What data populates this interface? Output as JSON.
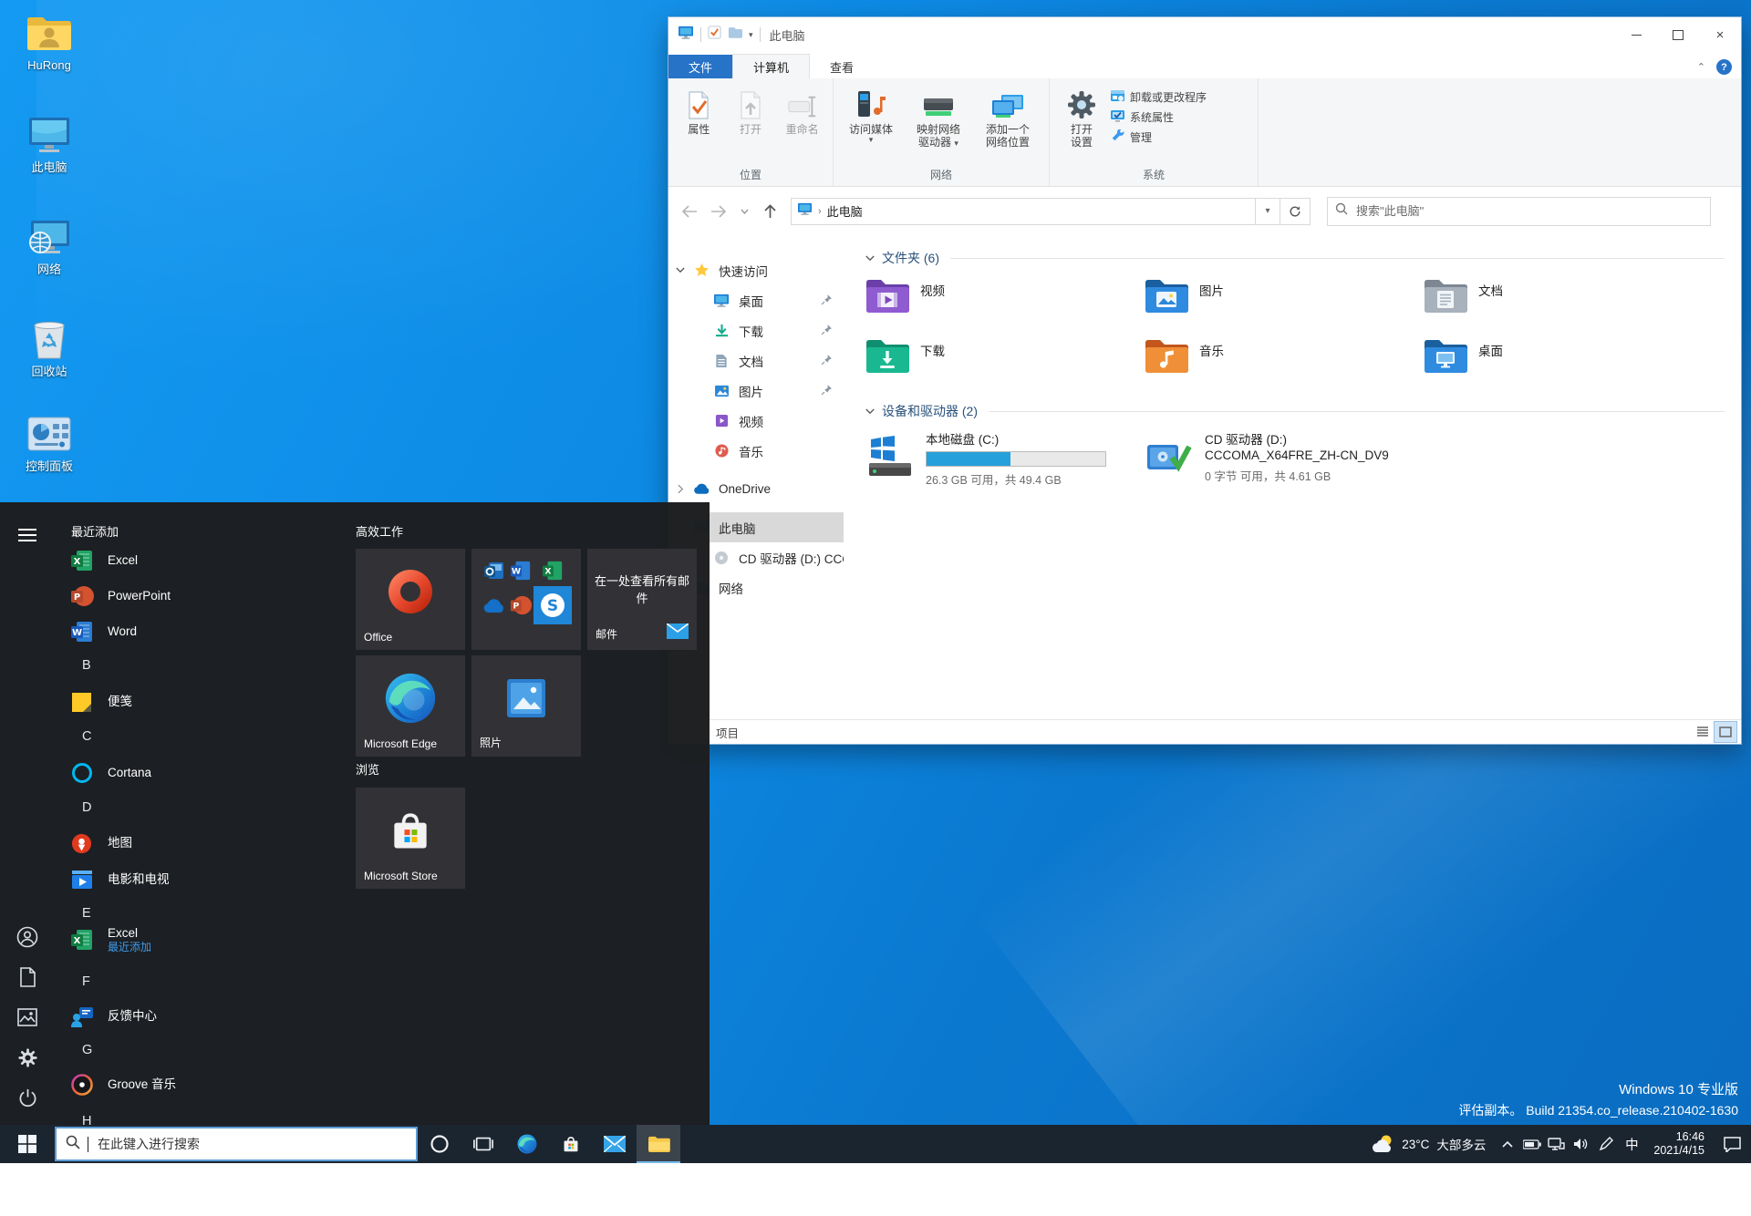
{
  "desktop": {
    "icons": [
      {
        "key": "hurong",
        "label": "HuRong"
      },
      {
        "key": "thispc",
        "label": "此电脑"
      },
      {
        "key": "network",
        "label": "网络"
      },
      {
        "key": "recycle",
        "label": "回收站"
      },
      {
        "key": "controlpanel",
        "label": "控制面板"
      }
    ],
    "watermark1": "Windows 10 专业版",
    "watermark2": "评估副本。 Build 21354.co_release.210402-1630"
  },
  "explorer": {
    "title": "此电脑",
    "tabs": {
      "file": "文件",
      "computer": "计算机",
      "view": "查看"
    },
    "ribbon": {
      "loc_group": {
        "label": "位置",
        "properties": "属性",
        "open": "打开",
        "rename": "重命名"
      },
      "net_group": {
        "label": "网络",
        "media": "访问媒体",
        "map1": "映射网络",
        "map2": "驱动器",
        "add1": "添加一个",
        "add2": "网络位置"
      },
      "sys_group": {
        "label": "系统",
        "settings1": "打开",
        "settings2": "设置",
        "uninstall": "卸载或更改程序",
        "sysprops": "系统属性",
        "manage": "管理"
      }
    },
    "address": "此电脑",
    "search_placeholder": "搜索\"此电脑\"",
    "sidebar": {
      "quick_access": "快速访问",
      "quick_items": [
        {
          "key": "desktop",
          "label": "桌面",
          "pinned": true
        },
        {
          "key": "downloads",
          "label": "下载",
          "pinned": true
        },
        {
          "key": "documents",
          "label": "文档",
          "pinned": true
        },
        {
          "key": "pictures",
          "label": "图片",
          "pinned": true
        },
        {
          "key": "videos",
          "label": "视频",
          "pinned": false
        },
        {
          "key": "music",
          "label": "音乐",
          "pinned": false
        }
      ],
      "onedrive": "OneDrive",
      "this_pc": "此电脑",
      "cd_drive": "CD 驱动器 (D:) CCC",
      "network": "网络"
    },
    "content": {
      "folders_header": "文件夹 (6)",
      "folders": [
        {
          "key": "videos",
          "name": "视频"
        },
        {
          "key": "pictures",
          "name": "图片"
        },
        {
          "key": "documents",
          "name": "文档"
        },
        {
          "key": "downloads",
          "name": "下载"
        },
        {
          "key": "music",
          "name": "音乐"
        },
        {
          "key": "desktop",
          "name": "桌面"
        }
      ],
      "drives_header": "设备和驱动器 (2)",
      "local_disk": {
        "name": "本地磁盘 (C:)",
        "info": "26.3 GB 可用，共 49.4 GB",
        "used_percent": 47
      },
      "cd_drive": {
        "name": "CD 驱动器 (D:)",
        "volume": "CCCOMA_X64FRE_ZH-CN_DV9",
        "info": "0 字节 可用，共 4.61 GB"
      }
    },
    "status_items": "项目"
  },
  "start_menu": {
    "recent_header": "最近添加",
    "app_list": [
      {
        "type": "app",
        "key": "excel",
        "label": "Excel"
      },
      {
        "type": "app",
        "key": "powerpoint",
        "label": "PowerPoint"
      },
      {
        "type": "app",
        "key": "word",
        "label": "Word"
      },
      {
        "type": "letter",
        "label": "B"
      },
      {
        "type": "app",
        "key": "stickynotes",
        "label": "便笺"
      },
      {
        "type": "letter",
        "label": "C"
      },
      {
        "type": "app",
        "key": "cortana",
        "label": "Cortana"
      },
      {
        "type": "letter",
        "label": "D"
      },
      {
        "type": "app",
        "key": "maps",
        "label": "地图"
      },
      {
        "type": "app",
        "key": "moviestv",
        "label": "电影和电视"
      },
      {
        "type": "letter",
        "label": "E"
      },
      {
        "type": "app",
        "key": "excel",
        "label": "Excel",
        "sub": "最近添加"
      },
      {
        "type": "letter",
        "label": "F"
      },
      {
        "type": "app",
        "key": "feedback",
        "label": "反馈中心"
      },
      {
        "type": "letter",
        "label": "G"
      },
      {
        "type": "app",
        "key": "groove",
        "label": "Groove 音乐"
      },
      {
        "type": "letter",
        "label": "H"
      }
    ],
    "tiles": {
      "group1": "高效工作",
      "office": "Office",
      "mail_headline": "在一处查看所有邮件",
      "mail_label": "邮件",
      "edge": "Microsoft Edge",
      "photos": "照片",
      "group2": "浏览",
      "store": "Microsoft Store"
    }
  },
  "taskbar": {
    "search_placeholder": "在此键入进行搜索",
    "weather_temp": "23°C",
    "weather_desc": "大部多云",
    "ime": "中",
    "time": "16:46",
    "date": "2021/4/15"
  },
  "colors": {
    "accent": "#2673c8",
    "desktop_blue": "#0d8ae4",
    "usage_fill": "#26a0da",
    "taskbar_bg": "#1b2530"
  }
}
